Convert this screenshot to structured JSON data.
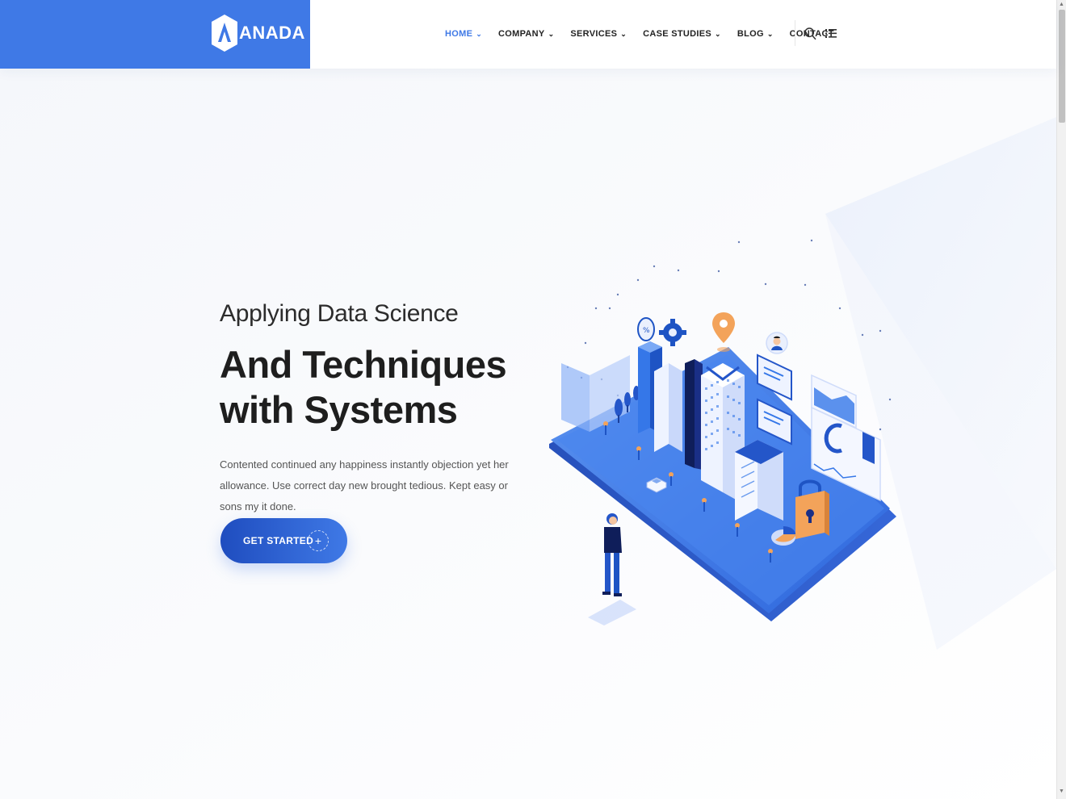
{
  "brand": {
    "name": "ANADA",
    "accent": "#3f79e6"
  },
  "nav": {
    "items": [
      {
        "label": "HOME",
        "has_dropdown": true,
        "active": true
      },
      {
        "label": "COMPANY",
        "has_dropdown": true,
        "active": false
      },
      {
        "label": "SERVICES",
        "has_dropdown": true,
        "active": false
      },
      {
        "label": "CASE STUDIES",
        "has_dropdown": true,
        "active": false
      },
      {
        "label": "BLOG",
        "has_dropdown": true,
        "active": false
      },
      {
        "label": "CONTACT",
        "has_dropdown": false,
        "active": false
      }
    ],
    "chevron": "⌄",
    "icons": [
      "search-icon",
      "menu-list-icon"
    ]
  },
  "hero": {
    "subtitle": "Applying Data Science",
    "title_line1": "And Techniques",
    "title_line2": "with Systems",
    "description": "Contented continued any happiness instantly objection yet her allowance. Use correct day new brought tedious. Kept easy or sons my it done.",
    "cta_label": "GET STARTED",
    "cta_icon": "+"
  },
  "illustration": {
    "type": "isometric-data-city",
    "icons": [
      "gear-icon",
      "map-pin-icon",
      "lock-icon",
      "user-avatar-icon",
      "percent-icon"
    ]
  }
}
